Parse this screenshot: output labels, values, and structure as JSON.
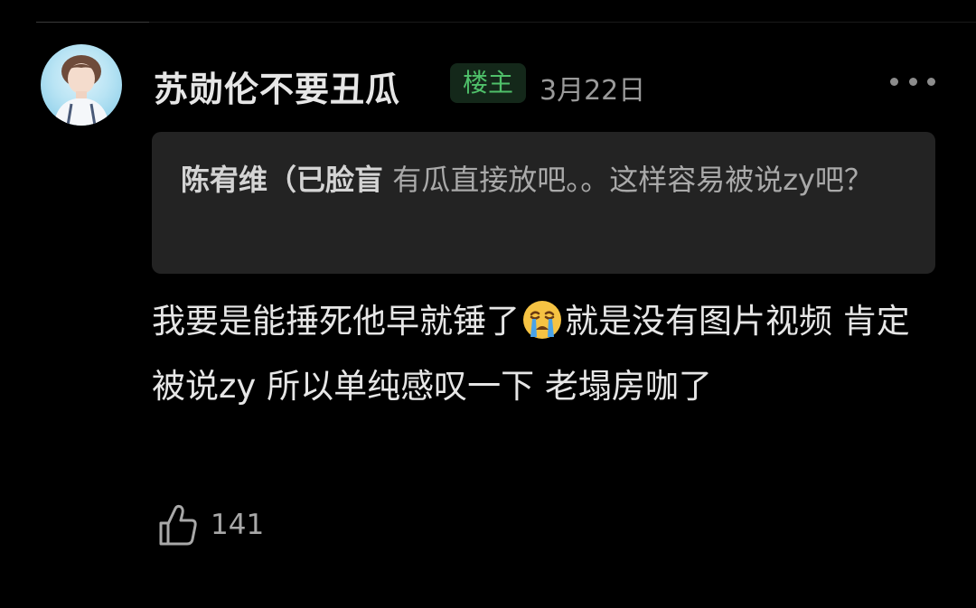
{
  "comment": {
    "username": "苏勋伦不要丑瓜",
    "op_badge": "楼主",
    "date": "3月22日",
    "more_icon": "more-dots-icon",
    "avatar_icon": "user-avatar",
    "quote": {
      "author": "陈宥维（已脸盲",
      "text": " 有瓜直接放吧。。这样容易被说zy吧？"
    },
    "body_part1": "我要是能捶死他早就锤了",
    "emoji_icon": "crying-face-emoji",
    "body_part2": "就是没有图片视频 肯定被说zy 所以单纯感叹一下 老塌房咖了",
    "like_icon": "thumbs-up-icon",
    "like_count": "141"
  },
  "colors": {
    "background": "#000000",
    "quote_bg": "#232323",
    "badge_bg": "#14281a",
    "badge_text": "#4fc06a",
    "muted_text": "#9a9a9a"
  }
}
